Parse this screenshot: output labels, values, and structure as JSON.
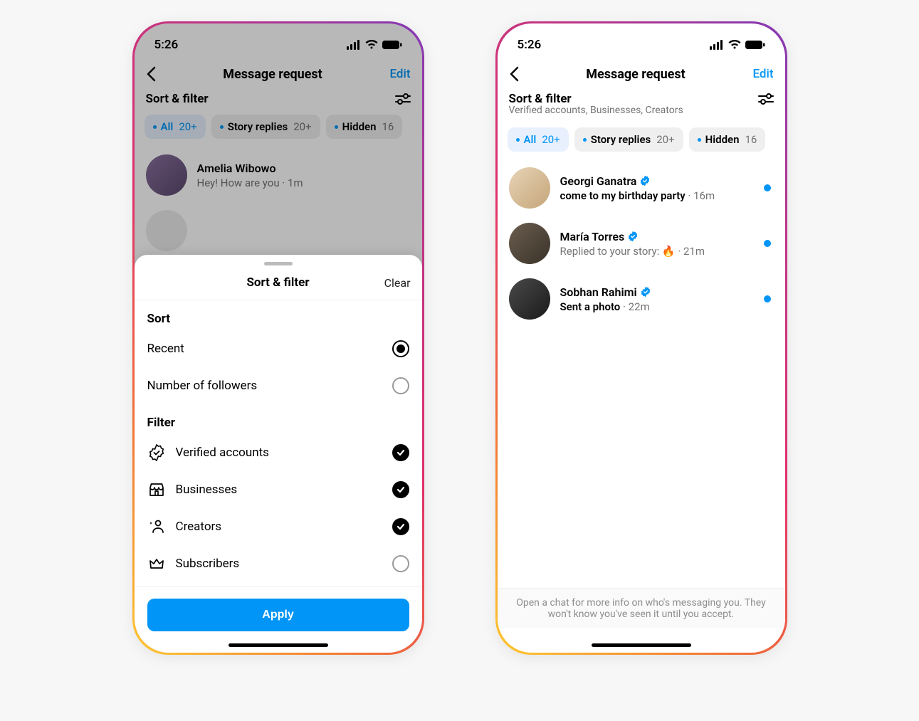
{
  "status": {
    "time": "5:26"
  },
  "nav": {
    "title": "Message request",
    "edit": "Edit"
  },
  "sort_filter_label": "Sort & filter",
  "filters_subtitle": "Verified accounts, Businesses, Creators",
  "chips": [
    {
      "label": "All",
      "count": "20+",
      "active": true
    },
    {
      "label": "Story replies",
      "count": "20+",
      "active": false
    },
    {
      "label": "Hidden",
      "count": "16",
      "active": false
    }
  ],
  "left": {
    "messages": [
      {
        "name": "Amelia Wibowo",
        "text": "Hey! How are you · 1m"
      }
    ]
  },
  "right": {
    "messages": [
      {
        "name": "Georgi Ganatra",
        "verified": true,
        "bold": "come to my birthday party",
        "time": "· 16m"
      },
      {
        "name": "María Torres",
        "verified": true,
        "plain": "Replied to your story: 🔥",
        "time": "· 21m"
      },
      {
        "name": "Sobhan Rahimi",
        "verified": true,
        "bold": "Sent a photo",
        "time": "· 22m"
      }
    ],
    "footer": "Open a chat for more info on who's messaging you. They won't know you've seen it until you accept."
  },
  "sheet": {
    "title": "Sort & filter",
    "clear": "Clear",
    "sort_label": "Sort",
    "sort_options": [
      {
        "label": "Recent",
        "selected": true
      },
      {
        "label": "Number of followers",
        "selected": false
      }
    ],
    "filter_label": "Filter",
    "filter_options": [
      {
        "label": "Verified accounts",
        "icon": "verified",
        "on": true
      },
      {
        "label": "Businesses",
        "icon": "storefront",
        "on": true
      },
      {
        "label": "Creators",
        "icon": "creator",
        "on": true
      },
      {
        "label": "Subscribers",
        "icon": "crown",
        "on": false
      }
    ],
    "apply": "Apply"
  }
}
